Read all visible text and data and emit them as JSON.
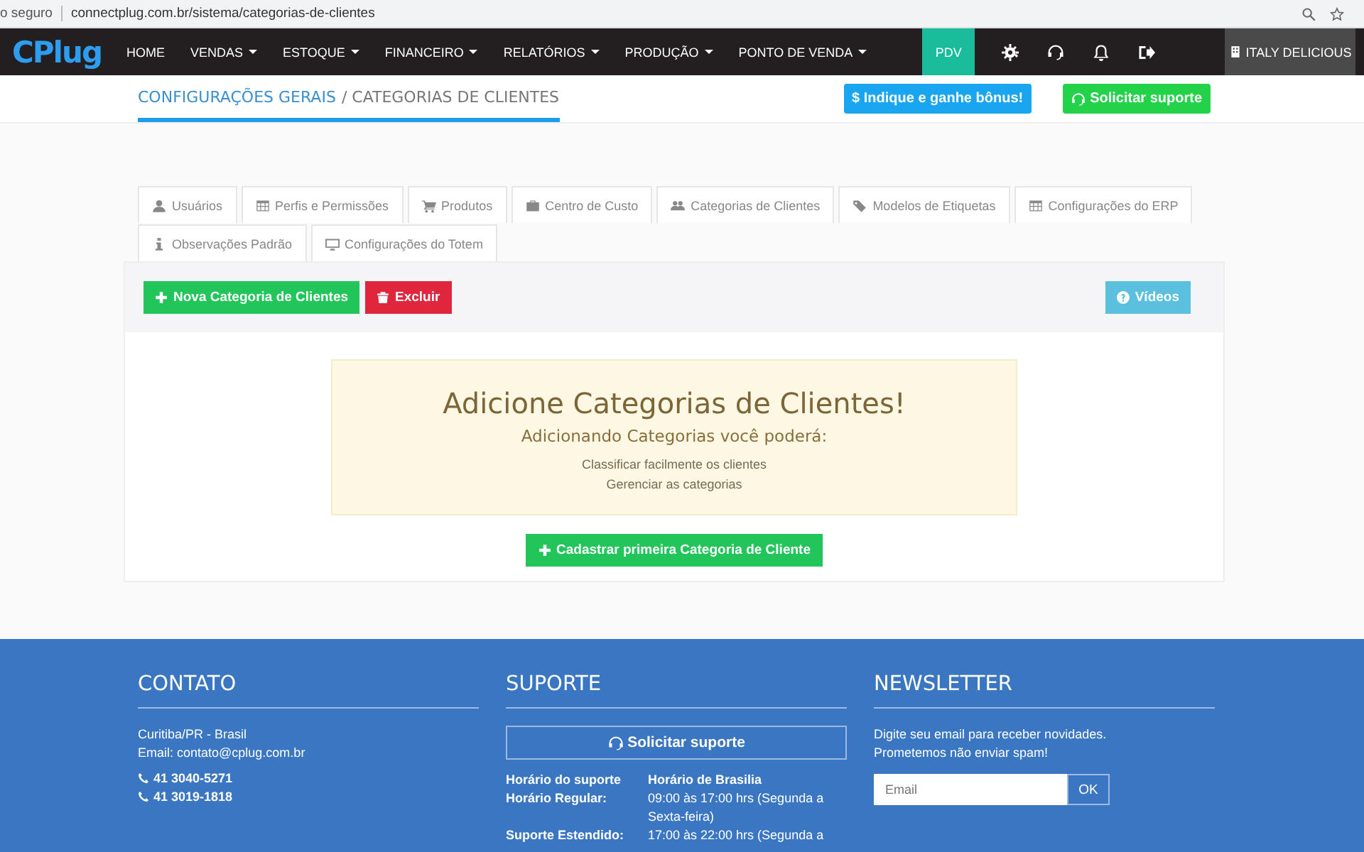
{
  "browser": {
    "address_prefix": "o seguro",
    "url": "connectplug.com.br/sistema/categorias-de-clientes"
  },
  "navbar": {
    "logo": "CPlug",
    "items": [
      {
        "label": "HOME",
        "has_menu": false
      },
      {
        "label": "VENDAS",
        "has_menu": true
      },
      {
        "label": "ESTOQUE",
        "has_menu": true
      },
      {
        "label": "FINANCEIRO",
        "has_menu": true
      },
      {
        "label": "RELATÓRIOS",
        "has_menu": true
      },
      {
        "label": "PRODUÇÃO",
        "has_menu": true
      },
      {
        "label": "PONTO DE VENDA",
        "has_menu": true
      }
    ],
    "pdv": "PDV",
    "account": "ITALY DELICIOUS"
  },
  "breadcrumb": {
    "parent": "CONFIGURAÇÕES GERAIS",
    "current": "/ CATEGORIAS DE CLIENTES"
  },
  "header_buttons": [
    {
      "label": "$ Indique e ganhe bônus!",
      "kind": "info"
    },
    {
      "label": "Solicitar suporte",
      "kind": "success"
    }
  ],
  "tabs": [
    {
      "label": "Usuários",
      "selected": false
    },
    {
      "label": "Perfis e Permissões",
      "selected": false
    },
    {
      "label": "Produtos",
      "selected": false
    },
    {
      "label": "Centro de Custo",
      "selected": false
    },
    {
      "label": "Categorias de Clientes",
      "selected": false
    },
    {
      "label": "Modelos de Etiquetas",
      "selected": false
    },
    {
      "label": "Configurações do ERP",
      "selected": false
    },
    {
      "label": "Observações Padrão",
      "selected": false
    },
    {
      "label": "Configurações do Totem",
      "selected": false
    }
  ],
  "toolbar": [
    {
      "label": "Nova Categoria de Clientes",
      "kind": "add"
    },
    {
      "label": "Excluir",
      "kind": "delete"
    },
    {
      "label": "Vídeos",
      "kind": "videos"
    }
  ],
  "empty_state": {
    "title": "Adicione Categorias de Clientes!",
    "subtitle": "Adicionando Categorias você poderá:",
    "items": [
      "Classificar facilmente os clientes",
      "Gerenciar as categorias"
    ],
    "button": "Cadastrar primeira Categoria de Cliente"
  },
  "footer": {
    "contact": {
      "title": "CONTATO",
      "lines": [
        "Curitiba/PR - Brasil",
        "Email: contato@cplug.com.br"
      ],
      "phones": [
        "41 3040-5271",
        "41 3019-1818"
      ]
    },
    "support": {
      "title": "SUPORTE",
      "button": "Solicitar suporte",
      "rows": [
        {
          "label": "Horário do suporte",
          "value": "Horário de Brasilia",
          "bold_value": true
        },
        {
          "label": "Horário Regular:",
          "value": "09:00 às 17:00 hrs (Segunda a Sexta-feira)",
          "bold_value": false
        },
        {
          "label": "Suporte Estendido:",
          "value": "17:00 às 22:00 hrs (Segunda a",
          "bold_value": false
        }
      ]
    },
    "newsletter": {
      "title": "NEWSLETTER",
      "lines": [
        "Digite seu email para receber novidades.",
        "Prometemos não enviar spam!"
      ],
      "placeholder": "Email",
      "button": "OK"
    }
  }
}
